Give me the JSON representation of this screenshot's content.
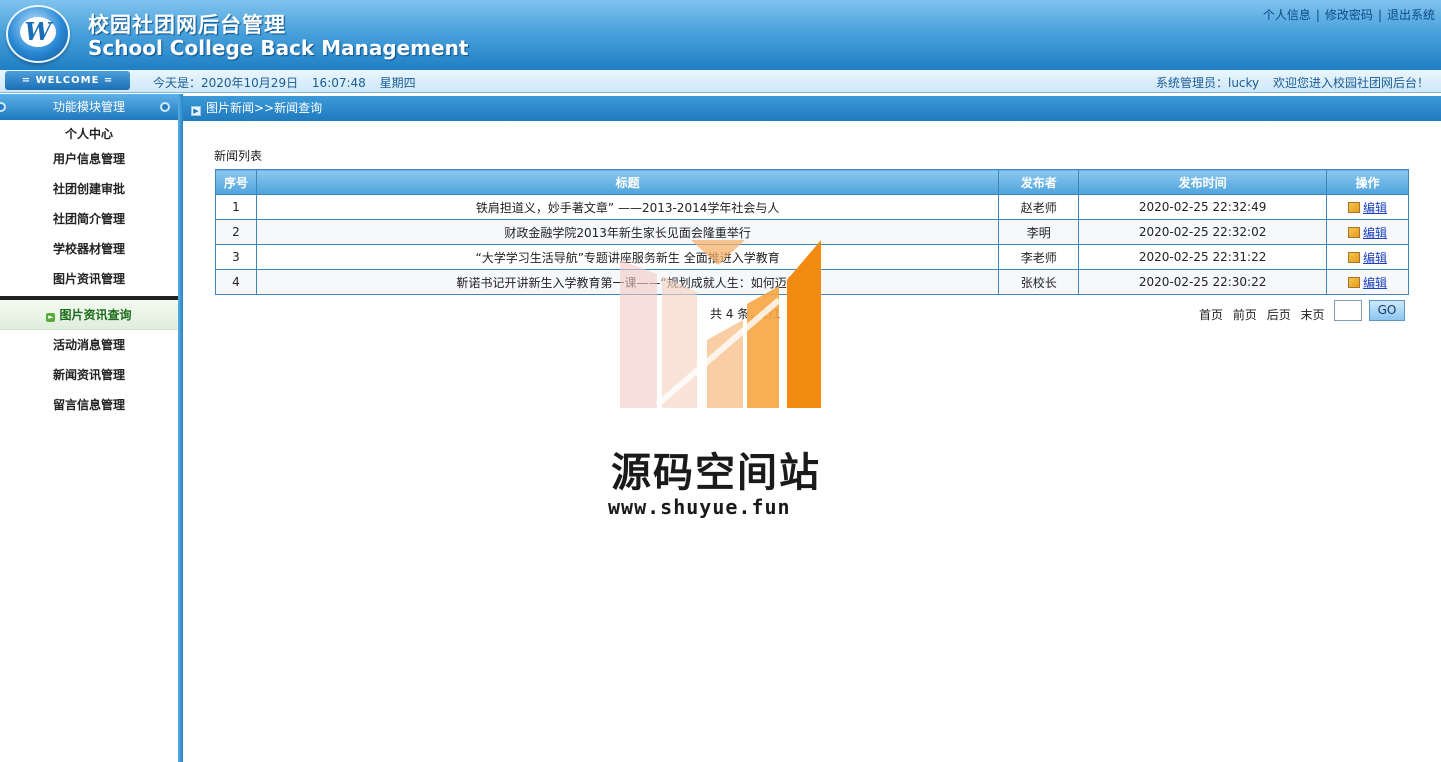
{
  "header": {
    "logo_letter": "W",
    "title_cn": "校园社团网后台管理",
    "title_en": "School College Back Management",
    "links": [
      "个人信息",
      "修改密码",
      "退出系统"
    ],
    "separator": "|"
  },
  "infobar": {
    "welcome": "= WELCOME =",
    "date": "今天是：2020年10月29日",
    "time": "16:07:48",
    "weekday": "星期四",
    "admin": "系统管理员：lucky",
    "greeting": "欢迎您进入校园社团网后台！"
  },
  "sidebar": {
    "heading": "功能模块管理",
    "items": [
      "个人中心",
      "用户信息管理",
      "社团创建审批",
      "社团简介管理",
      "学校器材管理",
      "图片资讯管理"
    ],
    "active_item": "图片资讯查询",
    "items_after": [
      "活动消息管理",
      "新闻资讯管理",
      "留言信息管理"
    ]
  },
  "breadcrumb": "图片新闻>>新闻查询",
  "list_label": "新闻列表",
  "table": {
    "headers": [
      "序号",
      "标题",
      "发布者",
      "发布时间",
      "操作"
    ],
    "rows": [
      {
        "no": "1",
        "title": "铁肩担道义，妙手著文章” ——2013-2014学年社会与人",
        "author": "赵老师",
        "time": "2020-02-25 22:32:49",
        "action": "编辑"
      },
      {
        "no": "2",
        "title": "财政金融学院2013年新生家长见面会隆重举行",
        "author": "李明",
        "time": "2020-02-25 22:32:02",
        "action": "编辑"
      },
      {
        "no": "3",
        "title": "“大学学习生活导航”专题讲座服务新生 全面推进入学教育",
        "author": "李老师",
        "time": "2020-02-25 22:31:22",
        "action": "编辑"
      },
      {
        "no": "4",
        "title": "靳诺书记开讲新生入学教育第一课——“规划成就人生：如何迈好",
        "author": "张校长",
        "time": "2020-02-25 22:30:22",
        "action": "编辑"
      }
    ]
  },
  "pager": {
    "count": "共 4 条，1/1",
    "links": [
      "首页",
      "前页",
      "后页",
      "末页"
    ],
    "go": "GO"
  },
  "watermark": {
    "name": "源码空间站",
    "url": "www.shuyue.fun"
  }
}
